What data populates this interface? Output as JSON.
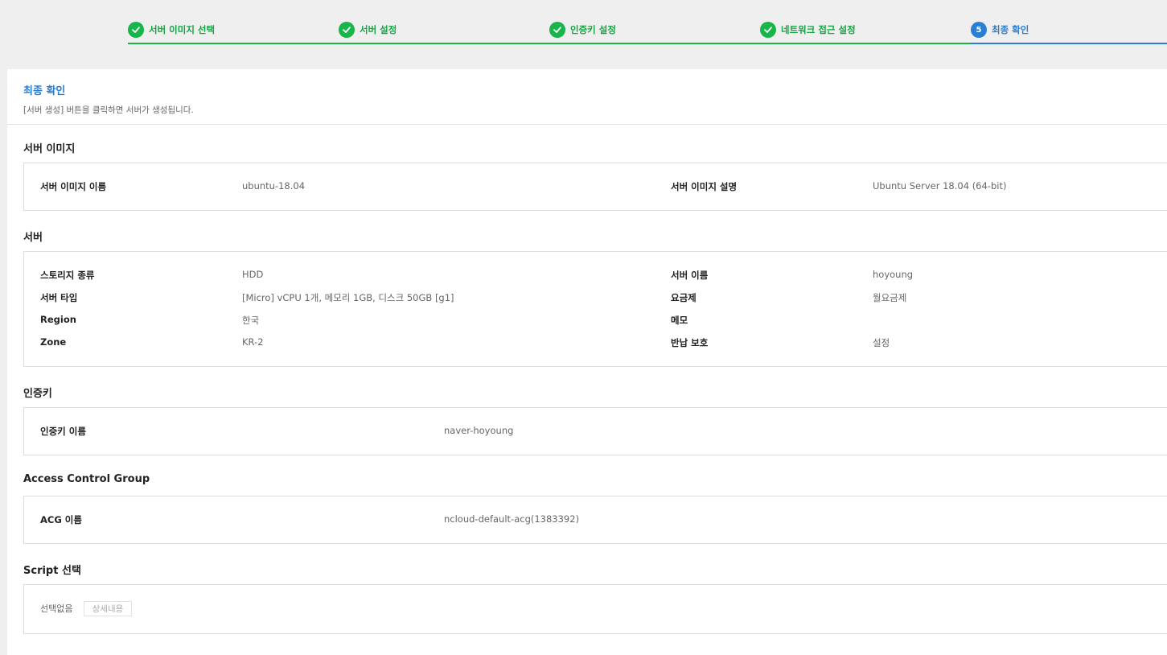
{
  "steps": [
    {
      "label": "서버 이미지 선택",
      "status": "done"
    },
    {
      "label": "서버 설정",
      "status": "done"
    },
    {
      "label": "인증키 설정",
      "status": "done"
    },
    {
      "label": "네트워크 접근 설정",
      "status": "done"
    },
    {
      "label": "최종 확인",
      "status": "active",
      "number": "5"
    }
  ],
  "header": {
    "title": "최종 확인",
    "description": "[서버 생성] 버튼을 클릭하면 서버가 생성됩니다."
  },
  "server_image": {
    "title": "서버 이미지",
    "name_label": "서버 이미지 이름",
    "name_value": "ubuntu-18.04",
    "desc_label": "서버 이미지 설명",
    "desc_value": "Ubuntu Server 18.04 (64-bit)"
  },
  "server": {
    "title": "서버",
    "storage_label": "스토리지 종류",
    "storage_value": "HDD",
    "type_label": "서버 타입",
    "type_value": "[Micro] vCPU 1개, 메모리 1GB, 디스크 50GB [g1]",
    "region_label": "Region",
    "region_value": "한국",
    "zone_label": "Zone",
    "zone_value": "KR-2",
    "name_label": "서버 이름",
    "name_value": "hoyoung",
    "billing_label": "요금제",
    "billing_value": "월요금제",
    "memo_label": "메모",
    "memo_value": "",
    "protect_label": "반납 보호",
    "protect_value": "설정"
  },
  "auth_key": {
    "title": "인증키",
    "name_label": "인증키 이름",
    "name_value": "naver-hoyoung"
  },
  "acg": {
    "title": "Access Control Group",
    "name_label": "ACG 이름",
    "name_value": "ncloud-default-acg(1383392)"
  },
  "script": {
    "title": "Script 선택",
    "empty_text": "선택없음",
    "detail_button": "상세내용"
  },
  "colors": {
    "done": "#17b54a",
    "active": "#2a7fd4"
  }
}
